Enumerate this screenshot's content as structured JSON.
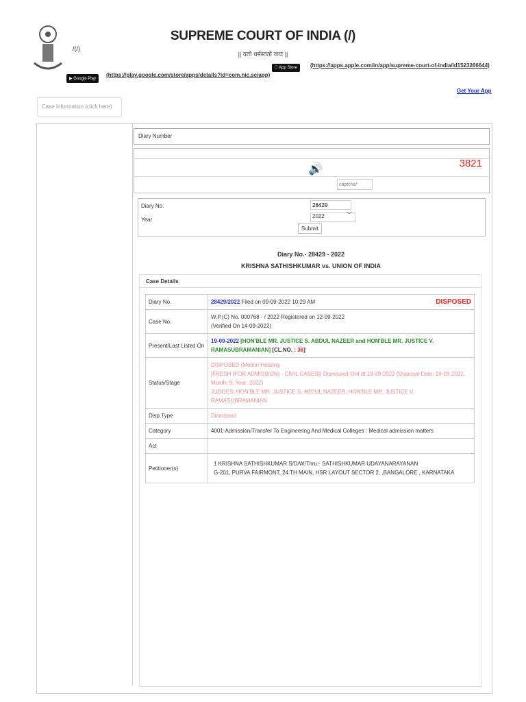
{
  "header": {
    "title": "SUPREME COURT OF INDIA (/)",
    "motto": "|| यतो धर्मस्ततो जयः ||",
    "logo_link": "/(/)",
    "play_link": "(https://play.google.com/store/apps/details?id=com.nic.sciapp)",
    "apple_link": "(https://apps.apple.com/in/app/supreme-court-of-india/id1523266644)",
    "google_badge": "Google Play",
    "apple_badge": "App Store",
    "get_app": "Get Your App"
  },
  "sidebar": {
    "case_info": "Case Information (click here)"
  },
  "form": {
    "tab": "Diary Number",
    "captcha_code": "3821",
    "captcha_placeholder": "captcha*",
    "diary_label": "Diary No.",
    "diary_value": "28429",
    "year_label": "Year",
    "year_value": "2022",
    "submit": "Submit"
  },
  "result": {
    "heading": "Diary No.- 28429 - 2022",
    "parties": "KRISHNA SATHISHKUMAR vs. UNION OF INDIA",
    "section": "Case Details",
    "rows": {
      "diary": {
        "label": "Diary No.",
        "number": "28429/2022",
        "filed": " Filed on 09-09-2022 10:29 AM",
        "status": "DISPOSED"
      },
      "case": {
        "label": "Case No.",
        "line1": "W.P.(C) No. 000768 - / 2022  Registered on 12-09-2022",
        "line2": "(Verified On 14-09-2022)"
      },
      "listed": {
        "label": "Present/Last Listed On",
        "date": "19-09-2022",
        "bench": " [HON'BLE MR. JUSTICE S. ABDUL NAZEER and HON'BLE MR. JUSTICE V. RAMASUBRAMANIAN]",
        "cl": " [CL.NO. : ",
        "cl_no": "36",
        "cl_end": "]"
      },
      "status": {
        "label": "Status/Stage",
        "line1": "DISPOSED (Motion Hearing",
        "line2": "[FRESH (FOR ADMISSION) - CIVIL CASES]) Dismissed-Ord dt:19-09-2022 (Disposal Date: 19-09-2022, Month: 9, Year: 2022)",
        "line3": "JUDGES: HON'BLE MR. JUSTICE S. ABDUL NAZEER, HON'BLE MR. JUSTICE V. RAMASUBRAMANIAN"
      },
      "disp": {
        "label": "Disp.Type",
        "value": "Dismissed"
      },
      "category": {
        "label": "Category",
        "value": "4001-Admission/Transfer To Engineering And Medical Colleges : Medical admission matters"
      },
      "act": {
        "label": "Act",
        "value": ""
      },
      "petitioner": {
        "label": "Petitioner(s)",
        "line1": "1 KRISHNA SATHISHKUMAR S/D/W/Thru:- SATHISHKUMAR UDAYANARAYANAN",
        "line2": "G-201, PURVA FAIRMONT, 24 TH MAIN, HSR LAYOUT SECTOR 2, ,BANGALORE , KARNATAKA"
      }
    }
  }
}
